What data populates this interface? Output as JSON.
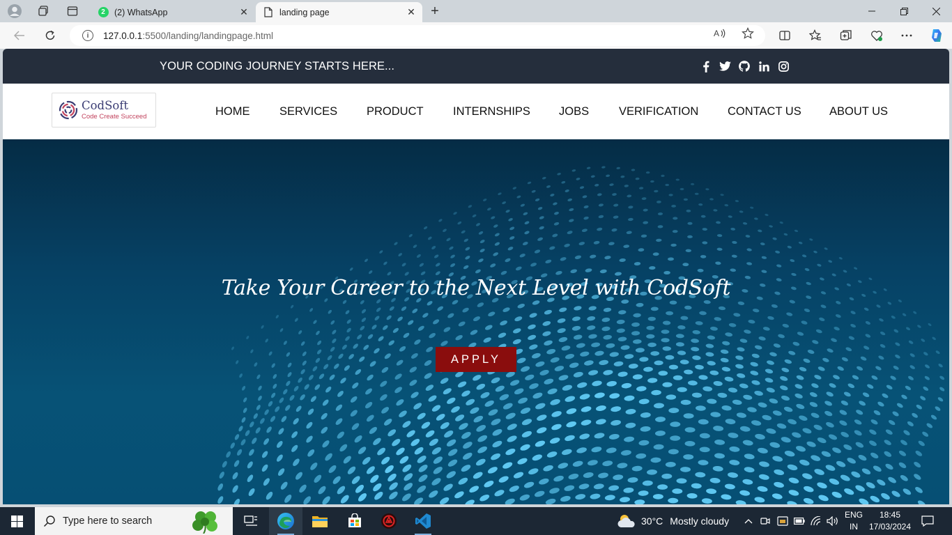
{
  "browser": {
    "tabs": [
      {
        "title": "(2) WhatsApp",
        "badge": "2",
        "active": false
      },
      {
        "title": "landing page",
        "active": true
      }
    ],
    "url_host": "127.0.0.1",
    "url_path": ":5500/landing/landingpage.html"
  },
  "page": {
    "topbar": {
      "tagline": "YOUR CODING JOURNEY STARTS HERE...",
      "social_icons": [
        "facebook-icon",
        "twitter-icon",
        "github-icon",
        "linkedin-icon",
        "instagram-icon"
      ]
    },
    "logo": {
      "name": "CodSoft",
      "subtitle": "Code Create Succeed"
    },
    "nav": [
      "HOME",
      "SERVICES",
      "PRODUCT",
      "INTERNSHIPS",
      "JOBS",
      "VERIFICATION",
      "CONTACT US",
      "ABOUT US"
    ],
    "hero": {
      "headline": "Take Your Career to the Next Level with CodSoft",
      "button": "APPLY"
    },
    "colors": {
      "topbar": "#252e3c",
      "hero": "#064164",
      "apply": "#8a0d0d",
      "dots": "#5fc8f2"
    }
  },
  "taskbar": {
    "search_placeholder": "Type here to search",
    "weather": {
      "temp": "30°C",
      "desc": "Mostly cloudy"
    },
    "lang": {
      "line1": "ENG",
      "line2": "IN"
    },
    "time": "18:45",
    "date": "17/03/2024"
  }
}
